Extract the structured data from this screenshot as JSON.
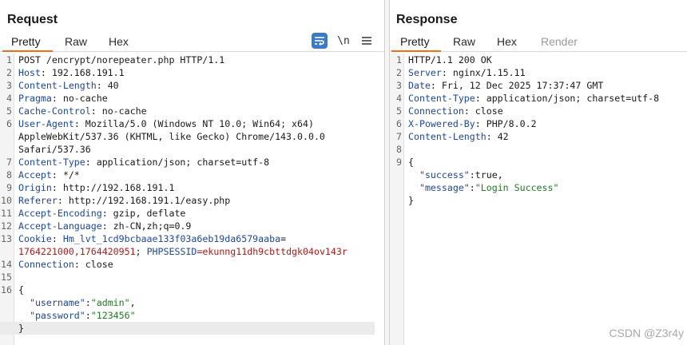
{
  "request": {
    "title": "Request",
    "tabs": [
      "Pretty",
      "Raw",
      "Hex"
    ],
    "tools": {
      "pretty_toggle": "pretty-format-icon",
      "newline": "\\n",
      "menu": "menu-icon"
    },
    "lines": [
      {
        "n": "1",
        "segments": [
          {
            "t": "POST /encrypt/norepeater.php HTTP/1.1"
          }
        ]
      },
      {
        "n": "2",
        "segments": [
          {
            "t": "Host",
            "c": "key"
          },
          {
            "t": ": 192.168.191.1"
          }
        ]
      },
      {
        "n": "3",
        "segments": [
          {
            "t": "Content-Length",
            "c": "key"
          },
          {
            "t": ": 40"
          }
        ]
      },
      {
        "n": "4",
        "segments": [
          {
            "t": "Pragma",
            "c": "key"
          },
          {
            "t": ": no-cache"
          }
        ]
      },
      {
        "n": "5",
        "segments": [
          {
            "t": "Cache-Control",
            "c": "key"
          },
          {
            "t": ": no-cache"
          }
        ]
      },
      {
        "n": "6",
        "segments": [
          {
            "t": "User-Agent",
            "c": "key"
          },
          {
            "t": ": Mozilla/5.0 (Windows NT 10.0; Win64; x64)"
          }
        ]
      },
      {
        "n": "",
        "segments": [
          {
            "t": "AppleWebKit/537.36 (KHTML, like Gecko) Chrome/143.0.0.0"
          }
        ]
      },
      {
        "n": "",
        "segments": [
          {
            "t": "Safari/537.36"
          }
        ]
      },
      {
        "n": "7",
        "segments": [
          {
            "t": "Content-Type",
            "c": "key"
          },
          {
            "t": ": application/json; charset=utf-8"
          }
        ]
      },
      {
        "n": "8",
        "segments": [
          {
            "t": "Accept",
            "c": "key"
          },
          {
            "t": ": */*"
          }
        ]
      },
      {
        "n": "9",
        "segments": [
          {
            "t": "Origin",
            "c": "key"
          },
          {
            "t": ": http://192.168.191.1"
          }
        ]
      },
      {
        "n": "10",
        "segments": [
          {
            "t": "Referer",
            "c": "key"
          },
          {
            "t": ": http://192.168.191.1/easy.php"
          }
        ]
      },
      {
        "n": "11",
        "segments": [
          {
            "t": "Accept-Encoding",
            "c": "key"
          },
          {
            "t": ": gzip, deflate"
          }
        ]
      },
      {
        "n": "12",
        "segments": [
          {
            "t": "Accept-Language",
            "c": "key"
          },
          {
            "t": ": zh-CN,zh;q=0.9"
          }
        ]
      },
      {
        "n": "13",
        "segments": [
          {
            "t": "Cookie",
            "c": "key"
          },
          {
            "t": ": "
          },
          {
            "t": "Hm_lvt_1cd9bcbaae133f03a6eb19da6579aaba",
            "c": "ckey"
          },
          {
            "t": "="
          }
        ]
      },
      {
        "n": "",
        "segments": [
          {
            "t": "1764221000,1764420951",
            "c": "cval"
          },
          {
            "t": "; "
          },
          {
            "t": "PHPSESSID",
            "c": "ckey"
          },
          {
            "t": "=",
            "c": "cval"
          },
          {
            "t": "ekunng11dh9cbttdgk04ov143r",
            "c": "cval"
          }
        ]
      },
      {
        "n": "14",
        "segments": [
          {
            "t": "Connection",
            "c": "key"
          },
          {
            "t": ": close"
          }
        ]
      },
      {
        "n": "15",
        "segments": [
          {
            "t": ""
          }
        ]
      },
      {
        "n": "16",
        "segments": [
          {
            "t": "{"
          }
        ]
      },
      {
        "n": "",
        "segments": [
          {
            "t": "  "
          },
          {
            "t": "\"username\"",
            "c": "jkey"
          },
          {
            "t": ":"
          },
          {
            "t": "\"admin\"",
            "c": "jstr"
          },
          {
            "t": ","
          }
        ]
      },
      {
        "n": "",
        "segments": [
          {
            "t": "  "
          },
          {
            "t": "\"password\"",
            "c": "jkey"
          },
          {
            "t": ":"
          },
          {
            "t": "\"123456\"",
            "c": "jstr"
          }
        ]
      },
      {
        "n": "",
        "hl": true,
        "segments": [
          {
            "t": "}"
          }
        ]
      }
    ]
  },
  "response": {
    "title": "Response",
    "tabs": [
      "Pretty",
      "Raw",
      "Hex",
      "Render"
    ],
    "lines": [
      {
        "n": "1",
        "segments": [
          {
            "t": "HTTP/1.1 200 OK"
          }
        ]
      },
      {
        "n": "2",
        "segments": [
          {
            "t": "Server",
            "c": "key"
          },
          {
            "t": ": nginx/1.15.11"
          }
        ]
      },
      {
        "n": "3",
        "segments": [
          {
            "t": "Date",
            "c": "key"
          },
          {
            "t": ": Fri, 12 Dec 2025 17:37:47 GMT"
          }
        ]
      },
      {
        "n": "4",
        "segments": [
          {
            "t": "Content-Type",
            "c": "key"
          },
          {
            "t": ": application/json; charset=utf-8"
          }
        ]
      },
      {
        "n": "5",
        "segments": [
          {
            "t": "Connection",
            "c": "key"
          },
          {
            "t": ": close"
          }
        ]
      },
      {
        "n": "6",
        "segments": [
          {
            "t": "X-Powered-By",
            "c": "key"
          },
          {
            "t": ": PHP/8.0.2"
          }
        ]
      },
      {
        "n": "7",
        "segments": [
          {
            "t": "Content-Length",
            "c": "key"
          },
          {
            "t": ": 42"
          }
        ]
      },
      {
        "n": "8",
        "segments": [
          {
            "t": ""
          }
        ]
      },
      {
        "n": "9",
        "segments": [
          {
            "t": "{"
          }
        ]
      },
      {
        "n": "",
        "segments": [
          {
            "t": "  "
          },
          {
            "t": "\"success\"",
            "c": "jkey"
          },
          {
            "t": ":true,"
          }
        ]
      },
      {
        "n": "",
        "segments": [
          {
            "t": "  "
          },
          {
            "t": "\"message\"",
            "c": "jkey"
          },
          {
            "t": ":"
          },
          {
            "t": "\"Login Success\"",
            "c": "jstr"
          }
        ]
      },
      {
        "n": "",
        "segments": [
          {
            "t": "}"
          }
        ]
      }
    ]
  },
  "watermark": "CSDN @Z3r4y",
  "colors": {
    "accent": "#f26b21",
    "header_key": "#1d47a8",
    "json_string": "#1f7a1f",
    "cookie_value": "#b01a1a",
    "toggle_bg": "#3b7bc4"
  }
}
